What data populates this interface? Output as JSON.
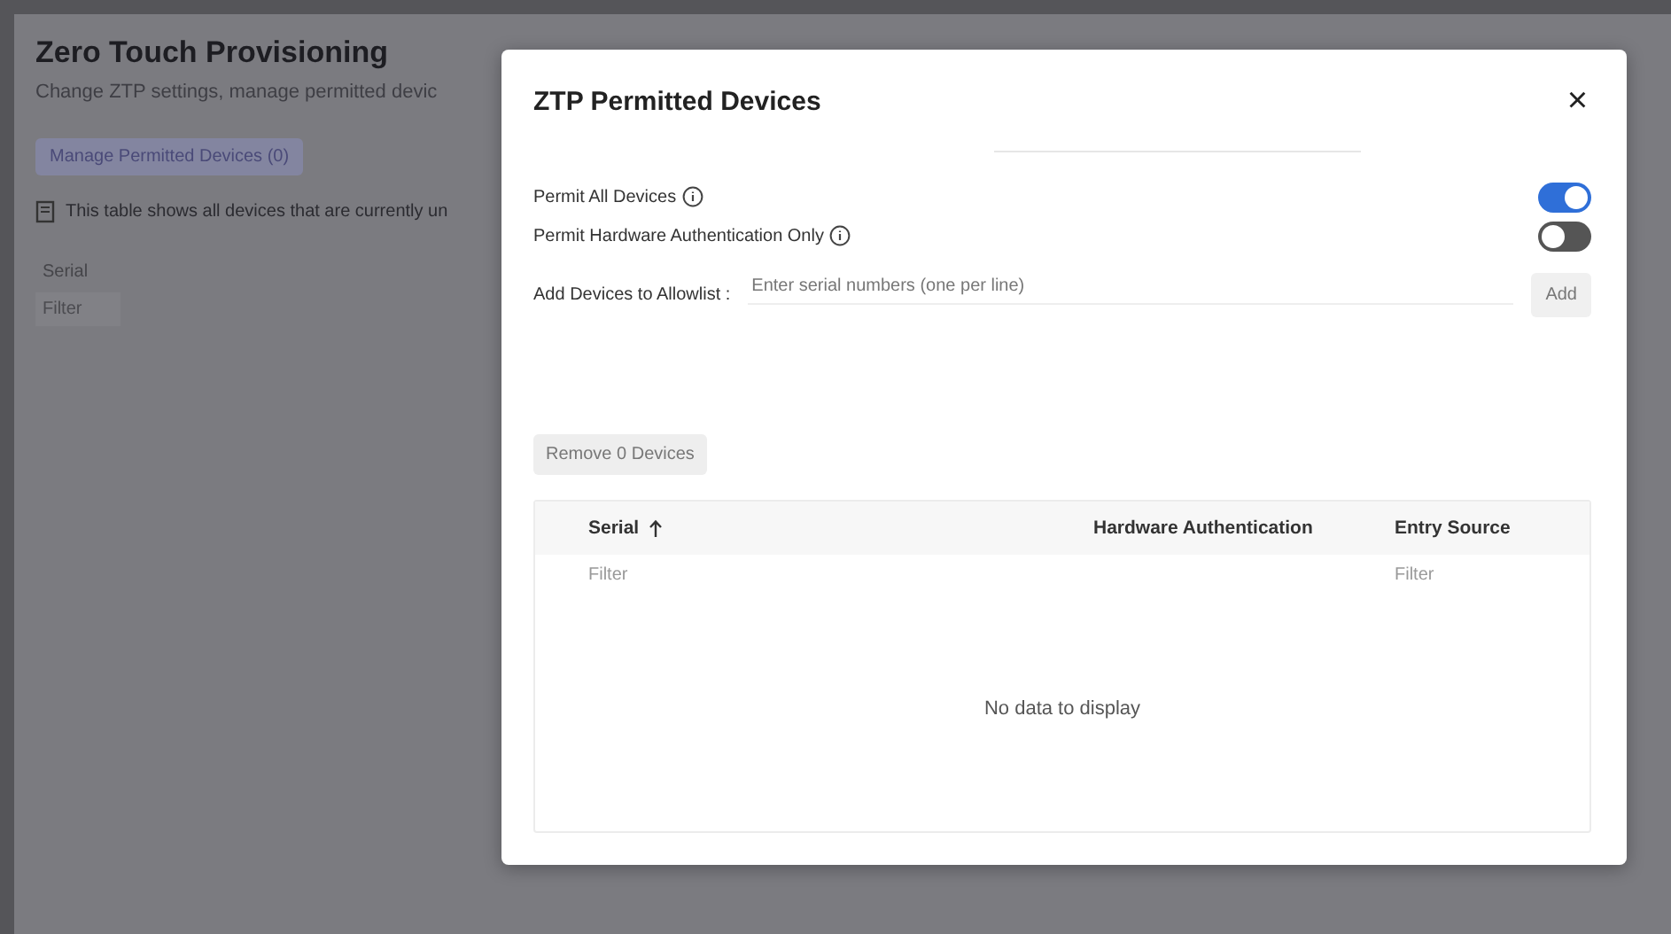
{
  "page": {
    "title": "Zero Touch Provisioning",
    "subtitle": "Change ZTP settings, manage permitted devic",
    "manage_button": "Manage Permitted Devices (0)",
    "info_text": "This table shows all devices that are currently un",
    "table": {
      "column": "Serial",
      "filter_placeholder": "Filter"
    }
  },
  "dialog": {
    "title": "ZTP Permitted Devices",
    "close": "×",
    "settings": [
      {
        "label": "Permit All Devices",
        "on": true
      },
      {
        "label": "Permit Hardware Authentication Only",
        "on": false
      }
    ],
    "allowlist": {
      "label": "Add Devices to Allowlist :",
      "placeholder": "Enter serial numbers (one per line)",
      "button": "Add"
    },
    "remove_button": "Remove 0 Devices",
    "table": {
      "columns": [
        {
          "label": "Serial",
          "sorted": true,
          "filter_placeholder": "Filter"
        },
        {
          "label": "Hardware Authentication",
          "sorted": false
        },
        {
          "label": "Entry Source",
          "sorted": false,
          "filter_placeholder": "Filter"
        }
      ],
      "empty_text": "No data to display"
    }
  }
}
